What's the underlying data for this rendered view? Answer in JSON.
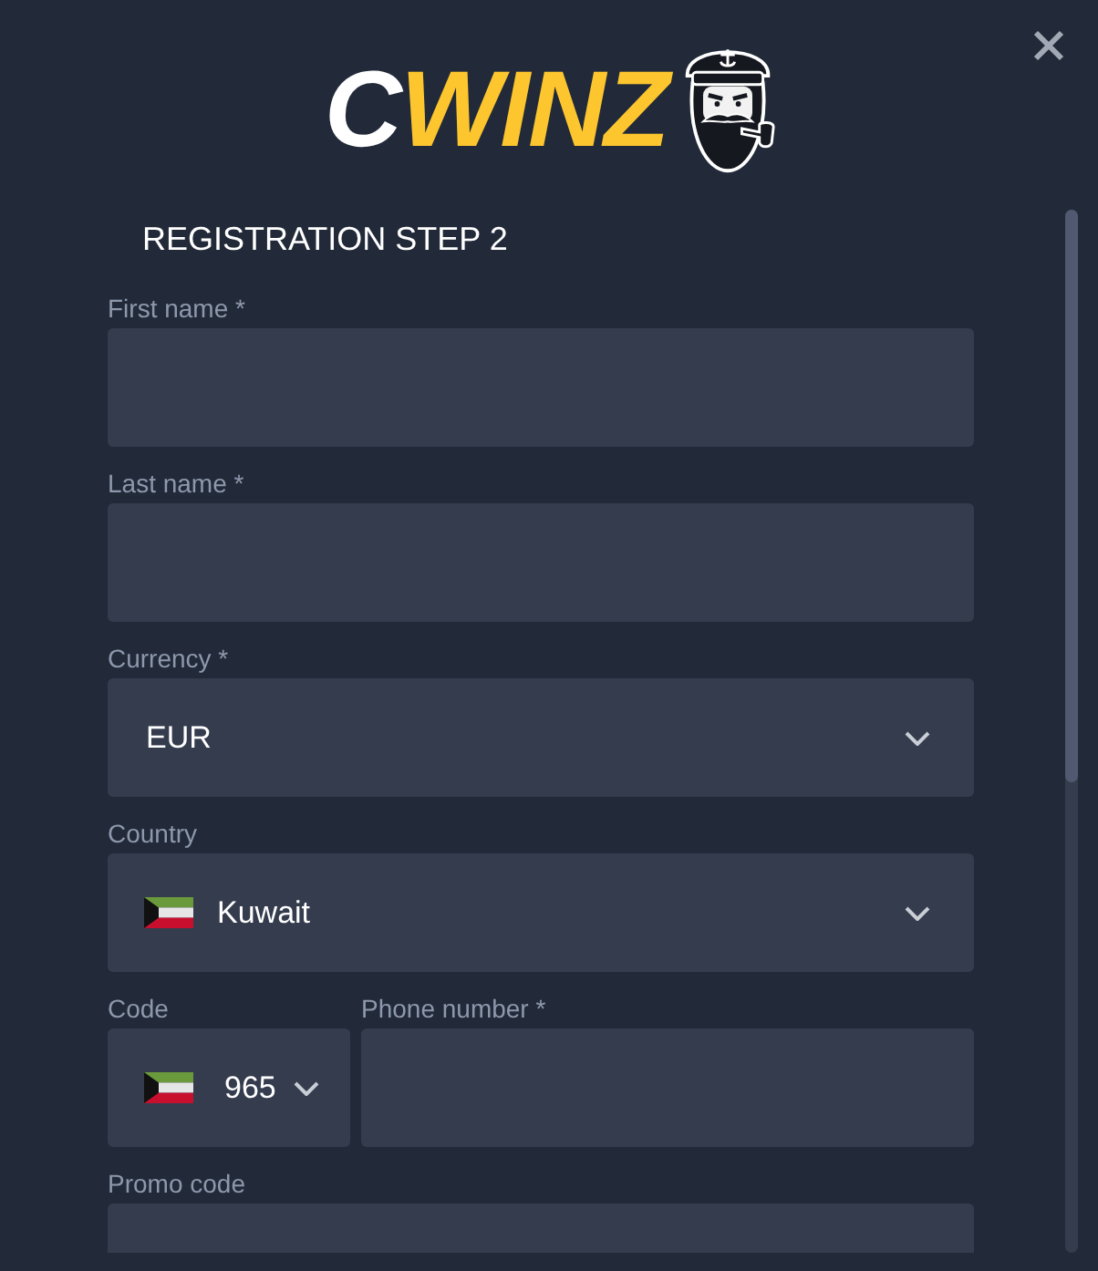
{
  "logo": {
    "wordmark": [
      {
        "text": "C",
        "accent": false
      },
      {
        "text": "WINZ",
        "accent": true
      }
    ]
  },
  "title": "REGISTRATION STEP 2",
  "fields": [
    {
      "kind": "text",
      "label": "First name *"
    },
    {
      "kind": "text",
      "label": "Last name *"
    },
    {
      "kind": "select",
      "label": "Currency *",
      "value": "EUR"
    },
    {
      "kind": "country",
      "label": "Country",
      "value": "Kuwait"
    },
    {
      "kind": "phone",
      "code": {
        "label": "Code",
        "value": "965"
      },
      "number": {
        "label": "Phone number *"
      }
    },
    {
      "kind": "text",
      "label": "Promo code"
    }
  ]
}
